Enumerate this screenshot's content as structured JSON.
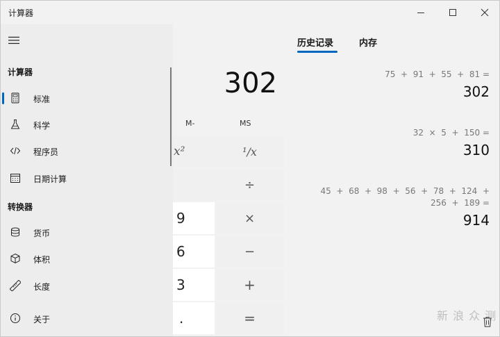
{
  "window": {
    "title": "计算器"
  },
  "sidebar": {
    "sections": [
      {
        "heading": "计算器",
        "items": [
          {
            "label": "标准",
            "icon": "standard-calculator-icon",
            "selected": true
          },
          {
            "label": "科学",
            "icon": "flask-icon"
          },
          {
            "label": "程序员",
            "icon": "code-icon"
          },
          {
            "label": "日期计算",
            "icon": "calendar-icon"
          }
        ]
      },
      {
        "heading": "转换器",
        "items": [
          {
            "label": "货币",
            "icon": "currency-icon"
          },
          {
            "label": "体积",
            "icon": "cube-icon"
          },
          {
            "label": "长度",
            "icon": "ruler-icon"
          }
        ]
      }
    ],
    "about": {
      "label": "关于",
      "icon": "info-icon"
    }
  },
  "calculator": {
    "display": "302",
    "memory": {
      "m_minus": "M-",
      "ms": "MS"
    },
    "keys": {
      "square": "x²",
      "reciprocal": "¹/x",
      "divide": "÷",
      "nine": "9",
      "multiply": "×",
      "six": "6",
      "minus": "−",
      "three": "3",
      "plus": "+",
      "decimal": ".",
      "equals": "="
    }
  },
  "history_panel": {
    "tabs": [
      {
        "label": "历史记录",
        "active": true
      },
      {
        "label": "内存",
        "active": false
      }
    ],
    "entries": [
      {
        "expression": "75  +  91  +  55  +  81 =",
        "result": "302"
      },
      {
        "expression": "32  ×  5  +  150 =",
        "result": "310"
      },
      {
        "expression": "45  +  68  +  98  +  56  +  78  +  124  +\n256  +  189 =",
        "result": "914"
      }
    ]
  },
  "watermark": "新 浪 众 测"
}
